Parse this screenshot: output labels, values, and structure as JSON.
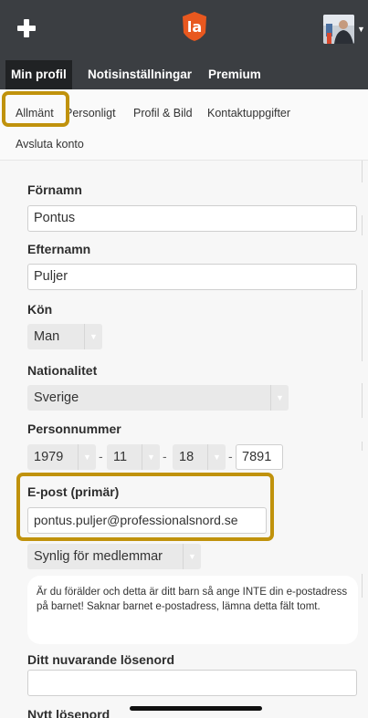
{
  "header": {
    "plus_icon": "plus-icon",
    "logo_text": "la",
    "logo_color": "#e8581f",
    "avatar_icon": "user-avatar",
    "dropdown_icon": "caret-down-icon"
  },
  "tabs": [
    {
      "label": "Min profil",
      "active": true
    },
    {
      "label": "Notisinställningar",
      "active": false
    },
    {
      "label": "Premium",
      "active": false
    }
  ],
  "subnav": {
    "items": [
      "Allmänt",
      "Personligt",
      "Profil & Bild",
      "Kontaktuppgifter"
    ],
    "second_row": "Avsluta konto",
    "selected": "Allmänt"
  },
  "form": {
    "first_name": {
      "label": "Förnamn",
      "value": "Pontus"
    },
    "last_name": {
      "label": "Efternamn",
      "value": "Puljer"
    },
    "gender": {
      "label": "Kön",
      "value": "Man"
    },
    "nationality": {
      "label": "Nationalitet",
      "value": "Sverige"
    },
    "personal_number": {
      "label": "Personnummer",
      "year": "1979",
      "month": "11",
      "day": "18",
      "last_digits": "7891",
      "separator": "-"
    },
    "email": {
      "label": "E-post (primär)",
      "value": "pontus.puljer@professionalsnord.se"
    },
    "visibility": {
      "value": "Synlig för medlemmar"
    },
    "info_text": "Är du förälder och detta är ditt barn så ange INTE din e-postadress på barnet! Saknar barnet e-postadress, lämna detta fält tomt.",
    "current_password": {
      "label": "Ditt nuvarande lösenord",
      "value": ""
    },
    "new_password": {
      "label": "Nytt lösenord"
    }
  },
  "colors": {
    "header_bg": "#3b3e42",
    "active_tab_bg": "#202224",
    "highlight": "#c0920c"
  }
}
